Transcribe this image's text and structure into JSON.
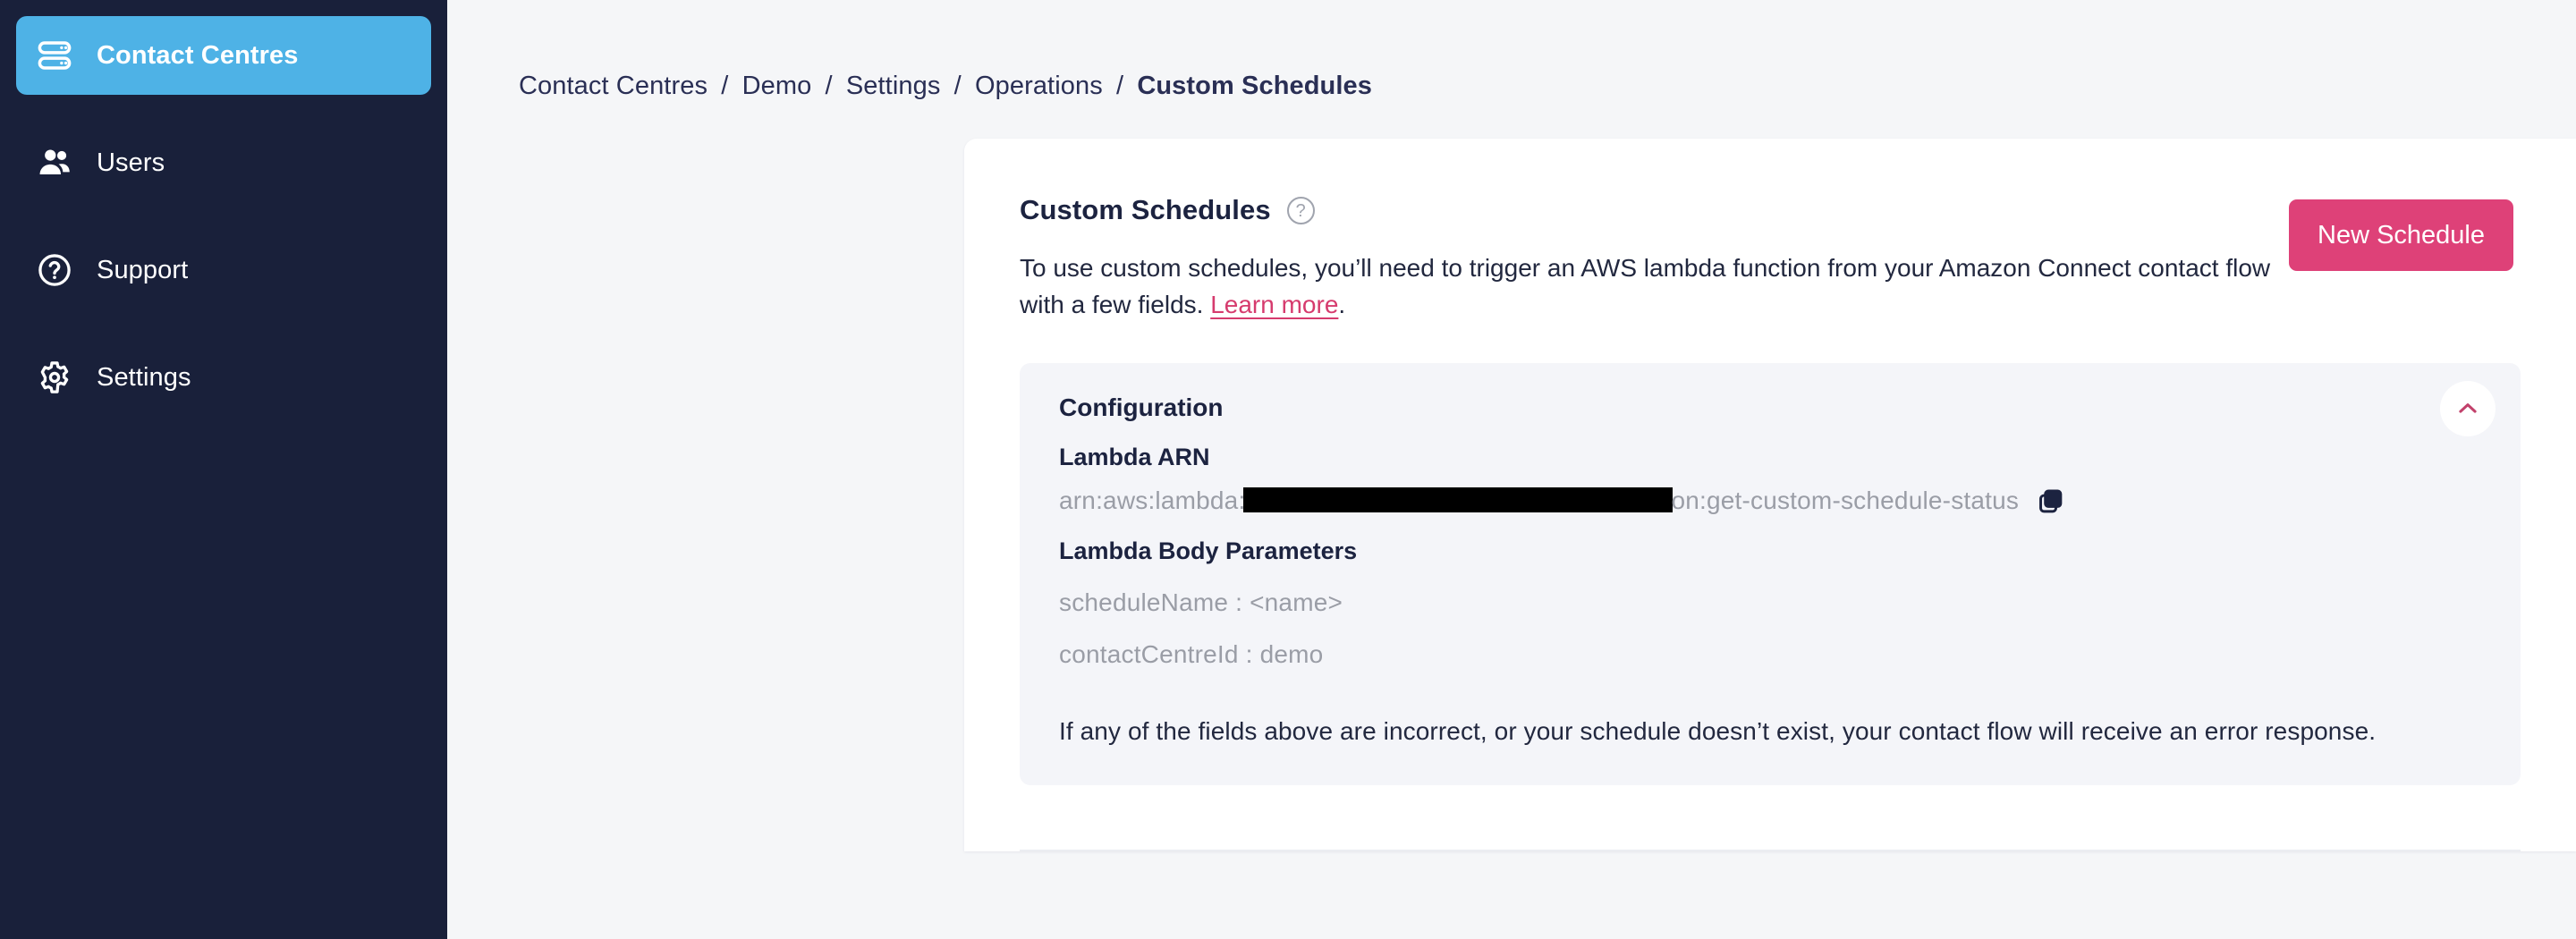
{
  "sidebar": {
    "items": [
      {
        "label": "Contact Centres",
        "icon": "server-stack-icon",
        "active": true
      },
      {
        "label": "Users",
        "icon": "users-icon",
        "active": false
      },
      {
        "label": "Support",
        "icon": "question-circle-icon",
        "active": false
      },
      {
        "label": "Settings",
        "icon": "gear-icon",
        "active": false
      }
    ],
    "active_color": "#4EB2E6",
    "background_color": "#19203A"
  },
  "breadcrumb": {
    "items": [
      "Contact Centres",
      "Demo",
      "Settings",
      "Operations",
      "Custom Schedules"
    ],
    "separator": "/",
    "current": "Custom Schedules"
  },
  "card": {
    "title": "Custom Schedules",
    "help_icon": "question-circle-icon",
    "description_before_link": "To use custom schedules, you’ll need to trigger an AWS lambda function from your Amazon Connect contact flow with a few fields. ",
    "description_link": "Learn more",
    "description_after_link": ".",
    "new_schedule_label": "New Schedule",
    "new_schedule_color": "#DE4178",
    "link_color": "#D63B6E"
  },
  "configuration": {
    "heading": "Configuration",
    "collapse_icon": "chevron-up-icon",
    "collapse_icon_color": "#C2416B",
    "lambda_arn_label": "Lambda ARN",
    "lambda_arn_prefix": "arn:aws:lambda:",
    "lambda_arn_redacted": true,
    "lambda_arn_suffix": "on:get-custom-schedule-status",
    "copy_icon": "copy-icon",
    "body_params_label": "Lambda Body Parameters",
    "body_params": [
      "scheduleName : <name>",
      "contactCentreId : demo"
    ],
    "note": "If any of the fields above are incorrect, or your schedule doesn’t exist, your contact flow will receive an error response."
  }
}
